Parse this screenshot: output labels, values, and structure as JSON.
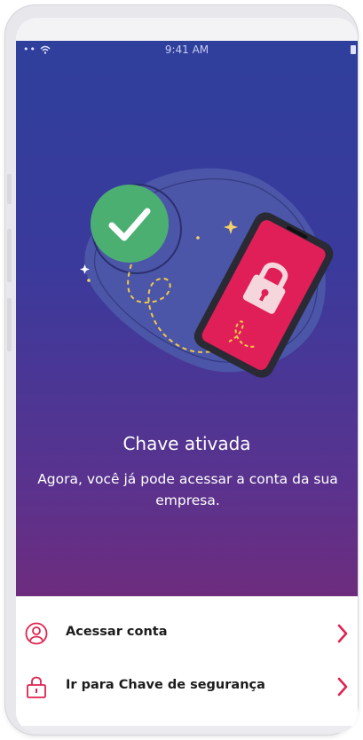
{
  "status_bar": {
    "signal": "•• ",
    "time": "9:41 AM"
  },
  "illustration": {
    "description_icons": [
      "check-circle-icon",
      "smartphone-icon",
      "padlock-icon",
      "sparkle-icon"
    ]
  },
  "main": {
    "title": "Chave ativada",
    "subtitle": "Agora, você já pode acessar a conta da sua empresa."
  },
  "menu": {
    "items": [
      {
        "label": "Acessar conta",
        "icon": "user-circle-icon"
      },
      {
        "label": "Ir para Chave de segurança",
        "icon": "padlock-icon"
      }
    ]
  },
  "colors": {
    "gradient_top": "#2f3f9c",
    "gradient_bottom": "#6d2c7e",
    "accent": "#e0224f",
    "check_green": "#4caf72",
    "phone_screen": "#e01f58"
  }
}
